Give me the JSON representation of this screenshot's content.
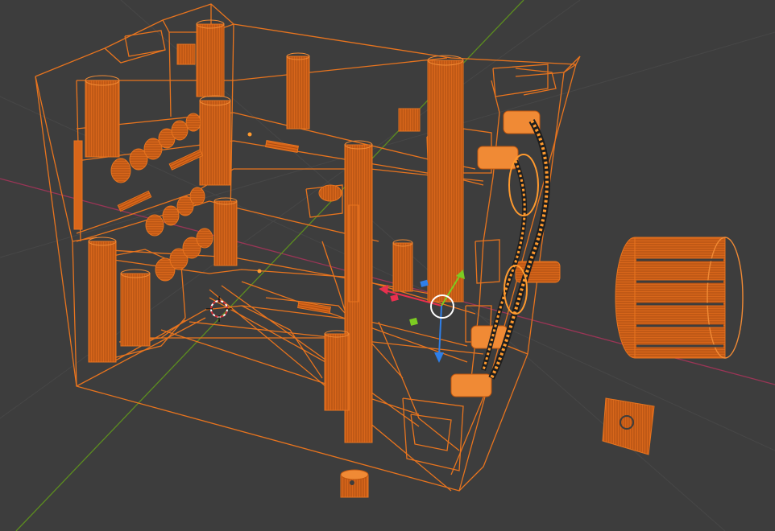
{
  "viewport": {
    "background": "#3d3d3d",
    "grid_color": "#454545",
    "axis_x_color": "#9a3556",
    "axis_y_color": "#5c8d1f",
    "wire_color": "#e8741e",
    "wire_active_color": "#ff9a2e",
    "wire_selected_color": "#f58a25",
    "gizmo": {
      "x_color": "#e8304e",
      "y_color": "#7ccb22",
      "z_color": "#2f7fe8",
      "center_ring_color": "#ffffff"
    },
    "cursor_icon": "3d-cursor-icon"
  }
}
